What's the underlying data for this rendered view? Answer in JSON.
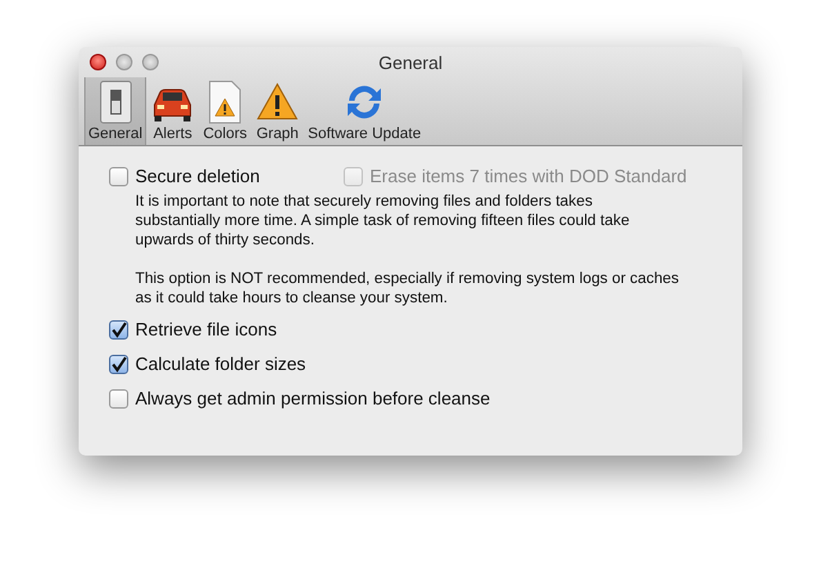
{
  "window": {
    "title": "General"
  },
  "toolbar": [
    {
      "label": "General",
      "kind": "switch",
      "selected": true
    },
    {
      "label": "Alerts",
      "kind": "car",
      "selected": false
    },
    {
      "label": "Colors",
      "kind": "document",
      "selected": false
    },
    {
      "label": "Graph",
      "kind": "warning",
      "selected": false
    },
    {
      "label": "Software Update",
      "kind": "sync",
      "selected": false
    }
  ],
  "secure_deletion": {
    "label": "Secure deletion",
    "checked": false
  },
  "erase_option": {
    "label": "Erase items 7 times with DOD Standard",
    "checked": false,
    "disabled": true
  },
  "description": [
    "It is important to note that securely removing files and folders takes substantially more time. A simple task of removing fifteen files could take upwards of thirty seconds.",
    "This option is NOT recommended, especially if removing system logs or caches as it could take hours to cleanse your system."
  ],
  "options": [
    {
      "label": "Retrieve file icons",
      "checked": true
    },
    {
      "label": "Calculate folder sizes",
      "checked": true
    },
    {
      "label": "Always get admin permission before cleanse",
      "checked": false
    }
  ]
}
